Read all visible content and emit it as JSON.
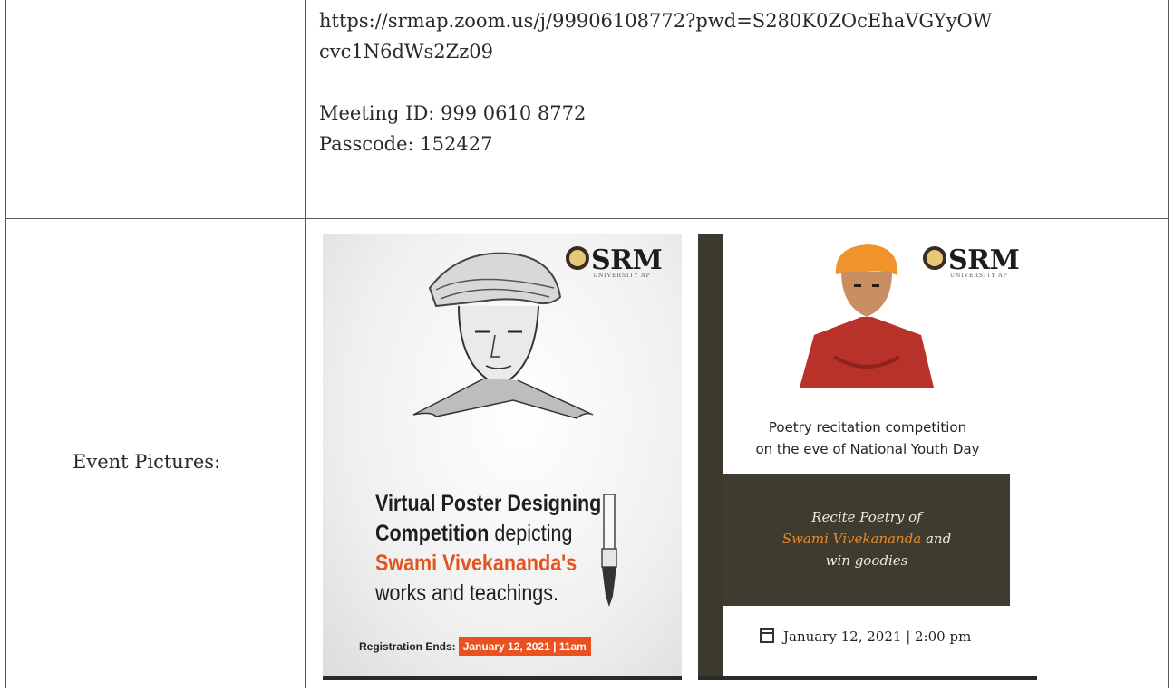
{
  "meeting": {
    "url_line1": "https://srmap.zoom.us/j/99906108772?pwd=S280K0ZOcEhaVGYyOW",
    "url_line2": "cvc1N6dWs2Zz09",
    "meeting_id": "Meeting ID: 999 0610 8772",
    "passcode": "Passcode: 152427"
  },
  "event_pictures_label": "Event Pictures:",
  "poster1": {
    "logo": "SRM",
    "logo_sub": "UNIVERSITY AP",
    "line1": "Virtual Poster Designing",
    "line2_bold": "Competition",
    "line2_rest": " depicting",
    "line3": "Swami Vivekananda's",
    "line4": "works and teachings.",
    "reg_label": "Registration Ends:",
    "reg_date": "January 12, 2021 | 11am",
    "colors": {
      "accent": "#e9511e"
    }
  },
  "poster2": {
    "logo": "SRM",
    "logo_sub": "UNIVERSITY AP",
    "title_line1": "Poetry recitation competition",
    "title_line2": "on the eve of National Youth Day",
    "box_line1": "Recite Poetry of",
    "box_hl": "Swami Vivekananda",
    "box_line2_rest": " and",
    "box_line3": "win goodies",
    "date": "January 12, 2021 | 2:00 pm",
    "colors": {
      "box": "#3f3b2e",
      "highlight": "#e8892a"
    }
  }
}
